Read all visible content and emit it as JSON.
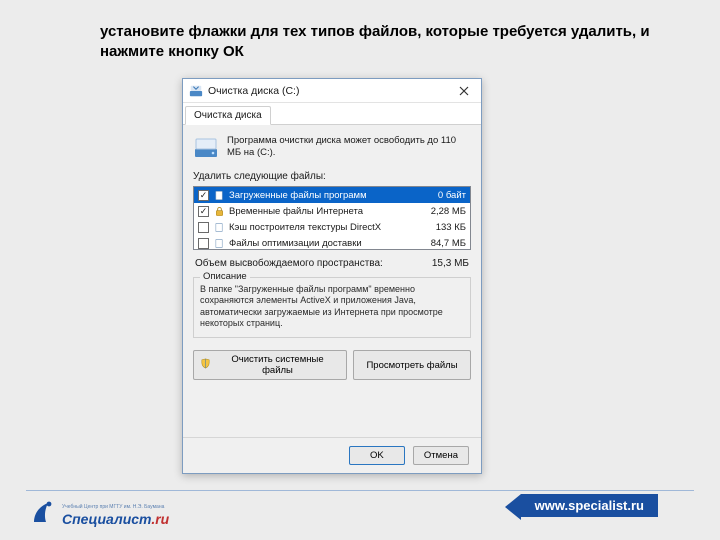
{
  "instruction": "установите флажки для тех типов файлов, которые требуется удалить, и нажмите кнопку ОК",
  "window": {
    "title": "Очистка диска (C:)",
    "tab": "Очистка диска",
    "info": "Программа очистки диска может освободить до 110 МБ на (C:).",
    "list_label": "Удалить следующие файлы:",
    "items": [
      {
        "checked": true,
        "locked": false,
        "selected": true,
        "name": "Загруженные файлы программ",
        "size": "0 байт"
      },
      {
        "checked": true,
        "locked": true,
        "selected": false,
        "name": "Временные файлы Интернета",
        "size": "2,28 МБ"
      },
      {
        "checked": false,
        "locked": false,
        "selected": false,
        "name": "Кэш построителя текстуры DirectX",
        "size": "133 КБ"
      },
      {
        "checked": false,
        "locked": false,
        "selected": false,
        "name": "Файлы оптимизации доставки",
        "size": "84,7 МБ"
      }
    ],
    "total_label": "Объем высвобождаемого пространства:",
    "total_value": "15,3 МБ",
    "group_title": "Описание",
    "description": "В папке \"Загруженные файлы программ\" временно сохраняются элементы ActiveX и приложения Java, автоматически загружаемые из Интернета при просмотре некоторых страниц.",
    "btn_clean_system": "Очистить системные файлы",
    "btn_view_files": "Просмотреть файлы",
    "btn_ok": "OK",
    "btn_cancel": "Отмена"
  },
  "footer": {
    "url": "www.specialist.ru",
    "logo_small": "Учебный Центр при МГТУ им. Н.Э. Баумана",
    "logo_main": "Специалист",
    "logo_suffix": ".ru"
  }
}
